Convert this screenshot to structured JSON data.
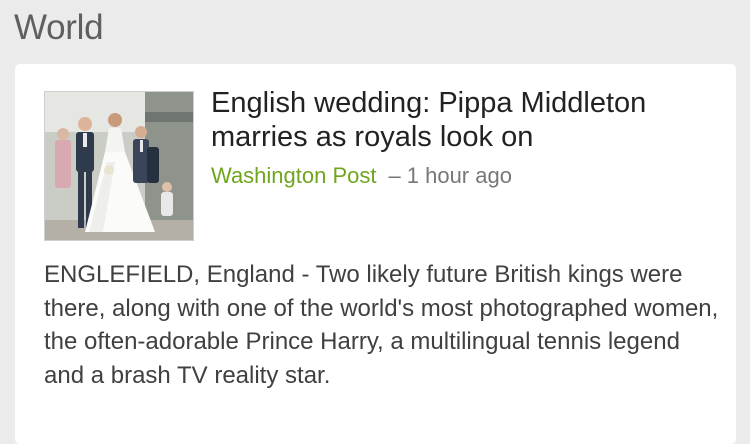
{
  "section": {
    "title": "World"
  },
  "article": {
    "headline": "English wedding: Pippa Middleton marries as royals look on",
    "source": "Washington Post",
    "separator": "–",
    "time": "1 hour ago",
    "snippet": "ENGLEFIELD, England - Two likely future British kings were there, along with one of the world's most photographed women, the often-adorable Prince Harry, a multilingual tennis legend and a brash TV reality star.",
    "thumbnail_icon": "wedding-photo"
  },
  "colors": {
    "background": "#ebebeb",
    "card": "#ffffff",
    "source_green": "#6fa51f",
    "headline": "#222222",
    "body_text": "#404040",
    "meta_gray": "#777777"
  }
}
